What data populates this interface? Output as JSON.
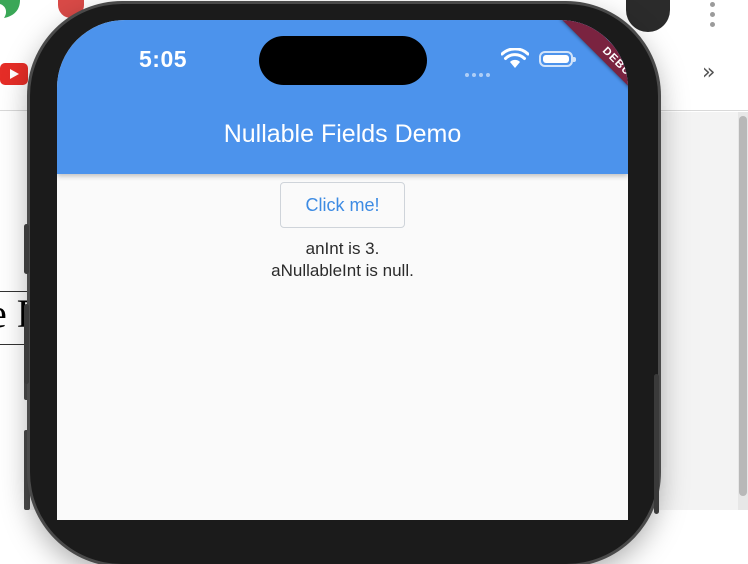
{
  "browser": {
    "overflow_chevrons": "»",
    "doc_fragment": "e F"
  },
  "status_bar": {
    "time": "5:05"
  },
  "app": {
    "title": "Nullable Fields Demo",
    "debug_banner": "DEBUG",
    "button_label": "Click me!",
    "line_an_int": "anInt is 3.",
    "line_nullable": "aNullableInt is null."
  },
  "colors": {
    "app_bar": "#4c93ec",
    "button_text": "#3d8be3",
    "debug_banner": "#7a2340",
    "screen_bg": "#fafafa"
  }
}
